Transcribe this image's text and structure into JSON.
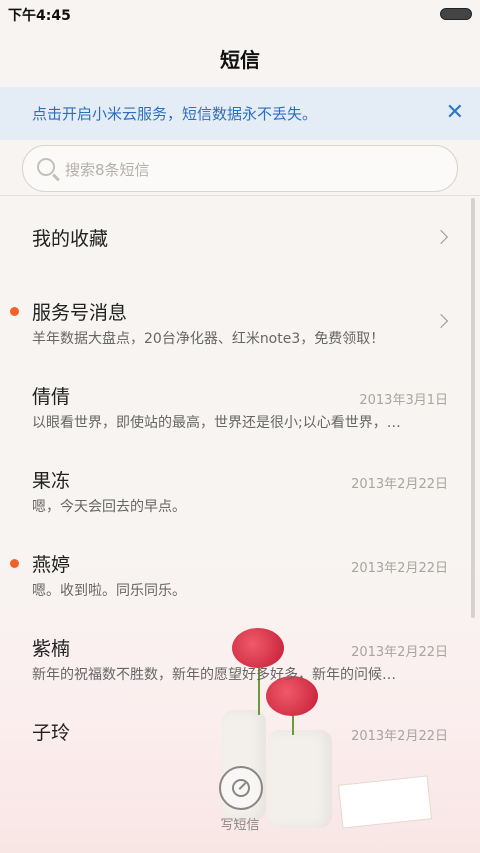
{
  "status_bar": {
    "time": "下午4:45"
  },
  "header": {
    "title": "短信"
  },
  "banner": {
    "text": "点击开启小米云服务，短信数据永不丢失。"
  },
  "search": {
    "placeholder": "搜索8条短信"
  },
  "favorites": {
    "label": "我的收藏"
  },
  "messages": [
    {
      "sender": "服务号消息",
      "preview": "羊年数据大盘点，20台净化器、红米note3，免费领取！",
      "date": "",
      "unread": true
    },
    {
      "sender": "倩倩",
      "preview": "以眼看世界，即使站的最高，世界还是很小;以心看世界，…",
      "date": "2013年3月1日",
      "unread": false
    },
    {
      "sender": "果冻",
      "preview": "嗯，今天会回去的早点。",
      "date": "2013年2月22日",
      "unread": false
    },
    {
      "sender": "燕婷",
      "preview": "嗯。收到啦。同乐同乐。",
      "date": "2013年2月22日",
      "unread": true
    },
    {
      "sender": "紫楠",
      "preview": "新年的祝福数不胜数，新年的愿望好多好多，新年的问候…",
      "date": "2013年2月22日",
      "unread": false
    },
    {
      "sender": "子玲",
      "preview": "",
      "date": "2013年2月22日",
      "unread": false
    }
  ],
  "compose": {
    "label": "写短信"
  },
  "colors": {
    "accent": "#2d6fbf",
    "unread_dot": "#f06227",
    "banner_bg": "#e4ecf5"
  },
  "icons": [
    "search-icon",
    "close-icon",
    "chevron-right-icon",
    "compose-icon",
    "battery-icon"
  ]
}
